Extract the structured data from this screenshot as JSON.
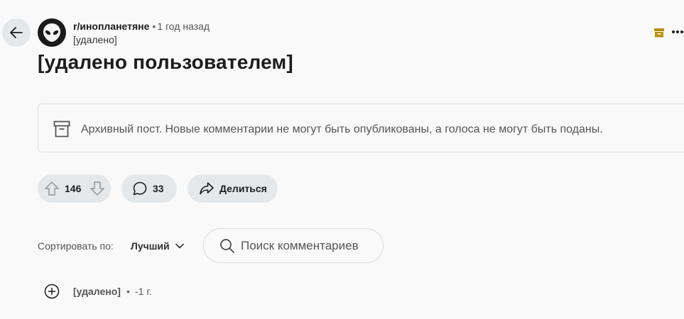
{
  "header": {
    "subreddit": "r/инопланетяне",
    "separator": "•",
    "time_ago": "1 год назад",
    "author": "[удалено]"
  },
  "post": {
    "title": "[удалено пользователем]",
    "archive_notice": "Архивный пост. Новые комментарии не могут быть опубликованы, а голоса не могут быть поданы."
  },
  "actions": {
    "score": "146",
    "comments": "33",
    "share_label": "Делиться"
  },
  "sort": {
    "label": "Сортировать по:",
    "value": "Лучший"
  },
  "search": {
    "placeholder": "Поиск комментариев"
  },
  "comment": {
    "author": "[удалено]",
    "separator": "•",
    "time": "-1 г."
  },
  "colors": {
    "background": "#f9f9f9",
    "pill": "#e5e8ea",
    "archive_badge": "#b8900b"
  },
  "icons": {
    "back": "arrow-left-icon",
    "avatar": "alien-icon",
    "archive_badge": "archive-icon",
    "more": "more-horizontal-icon",
    "upvote": "upvote-icon",
    "downvote": "downvote-icon",
    "comments": "comment-bubble-icon",
    "share": "share-icon",
    "sort": "chevron-down-icon",
    "search": "search-icon",
    "expand": "plus-circle-icon"
  }
}
